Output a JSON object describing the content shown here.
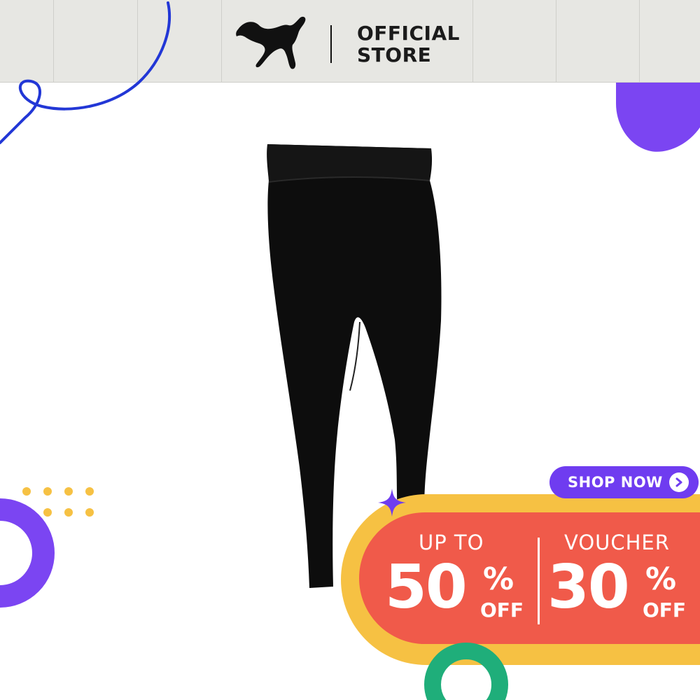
{
  "header": {
    "brand_line1": "OFFICIAL",
    "brand_line2": "STORE",
    "logo_icon": "puma-cat-logo-icon",
    "background_color": "#e7e7e3"
  },
  "product": {
    "image_icon": "black-capri-leggings-image"
  },
  "promo": {
    "shop_button_label": "SHOP NOW",
    "shop_button_icon": "chevron-right-icon",
    "left_caption": "UP TO",
    "left_value": "50",
    "left_percent": "%",
    "left_off": "OFF",
    "right_caption": "VOUCHER",
    "right_value": "30",
    "right_percent": "%",
    "right_off": "OFF"
  },
  "colors": {
    "accent_purple": "#6f3cf0",
    "promo_red": "#f05a4a",
    "promo_yellow": "#f6c143",
    "deco_blue": "#2237d6",
    "deco_green": "#1fae7a"
  }
}
